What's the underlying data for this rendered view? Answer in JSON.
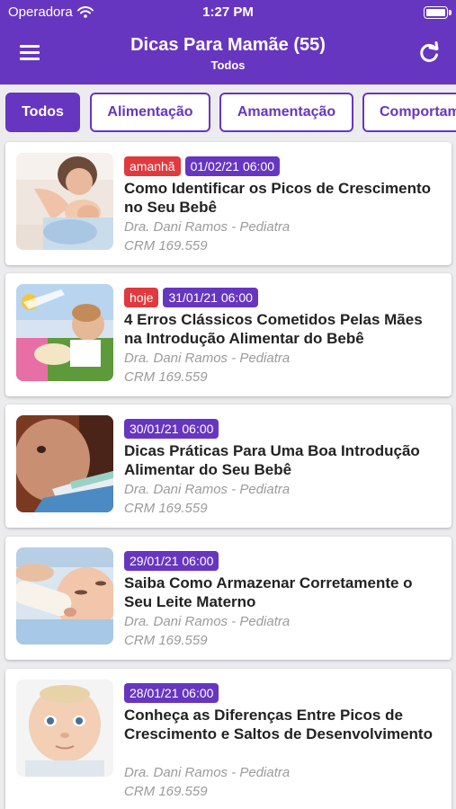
{
  "status_bar": {
    "carrier": "Operadora",
    "time": "1:27 PM"
  },
  "header": {
    "title": "Dicas Para Mamãe (55)",
    "subtitle": "Todos",
    "menu_icon": "hamburger-icon",
    "refresh_icon": "refresh-icon"
  },
  "tabs": [
    {
      "label": "Todos",
      "active": true
    },
    {
      "label": "Alimentação",
      "active": false
    },
    {
      "label": "Amamentação",
      "active": false
    },
    {
      "label": "Comportamento",
      "active": false
    }
  ],
  "colors": {
    "primary": "#6736c0",
    "badge_red": "#e03a3e",
    "meta_text": "#9b9b9b"
  },
  "articles": [
    {
      "tag": "amanhã",
      "date": "01/02/21 06:00",
      "title": "Como Identificar os Picos de Crescimento no Seu Bebê",
      "author": "Dra. Dani Ramos - Pediatra",
      "crm": "CRM 169.559"
    },
    {
      "tag": "hoje",
      "date": "31/01/21 06:00",
      "title": "4 Erros Clássicos Cometidos Pelas Mães na Introdução Alimentar do Bebê",
      "author": "Dra. Dani Ramos - Pediatra",
      "crm": "CRM 169.559"
    },
    {
      "tag": "",
      "date": "30/01/21 06:00",
      "title": "Dicas Práticas Para Uma Boa Introdução Alimentar do Seu Bebê",
      "author": "Dra. Dani Ramos - Pediatra",
      "crm": "CRM 169.559"
    },
    {
      "tag": "",
      "date": "29/01/21 06:00",
      "title": "Saiba Como Armazenar Corretamente o Seu Leite Materno",
      "author": "Dra. Dani Ramos - Pediatra",
      "crm": "CRM 169.559"
    },
    {
      "tag": "",
      "date": "28/01/21 06:00",
      "title": "Conheça as Diferenças Entre Picos de Crescimento e Saltos de Desenvolvimento",
      "author": "Dra. Dani Ramos - Pediatra",
      "crm": "CRM 169.559"
    }
  ]
}
